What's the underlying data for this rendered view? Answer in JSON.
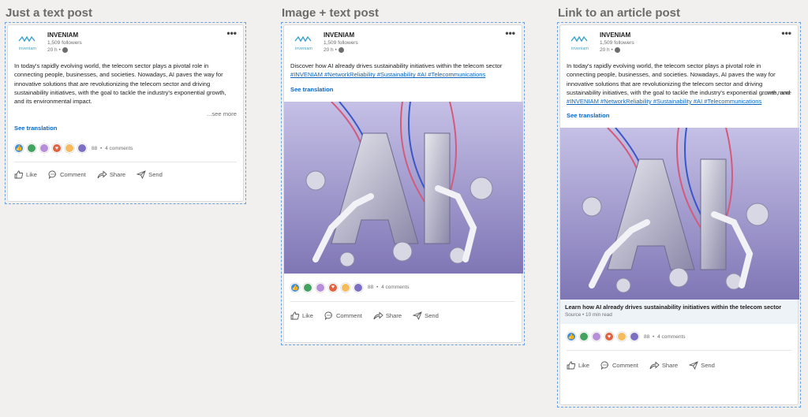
{
  "sections": [
    {
      "title": "Just a text post"
    },
    {
      "title": "Image + text post"
    },
    {
      "title": "Link to an article post"
    }
  ],
  "post": {
    "author": "INVENIAM",
    "logo_text": "inveniam",
    "followers": "1,509 followers",
    "time": "20 h •",
    "text_long": "In today's rapidly evolving world, the telecom sector plays a pivotal role in connecting people, businesses, and societies. Nowadays, AI paves the way for innovative solutions that are revolutionizing the telecom sector and driving sustainability initiatives, with the goal to tackle the industry's exponential growth, and its environmental impact.",
    "text_short": "Discover how AI already drives sustainability initiatives within the telecom sector",
    "hashtags": "#INVENIAM #NetworkReliability #Sustainability #AI #Telecommunications",
    "see_more": "...see more",
    "see_translation": "See translation",
    "reaction_count": "88",
    "comments": "4 comments",
    "actions": {
      "like": "Like",
      "comment": "Comment",
      "share": "Share",
      "send": "Send"
    },
    "more_menu": "•••"
  },
  "article": {
    "title": "Learn how AI already drives sustainability initiatives within the telecom sector",
    "meta": "Source  •  10 min read"
  },
  "colors": {
    "accent": "#0a66c2",
    "frame_border": "#6aa2e0",
    "image_bg": "#9b94c9"
  },
  "icons": [
    "more-icon",
    "globe-icon",
    "like-icon",
    "comment-icon",
    "share-icon",
    "send-icon"
  ]
}
